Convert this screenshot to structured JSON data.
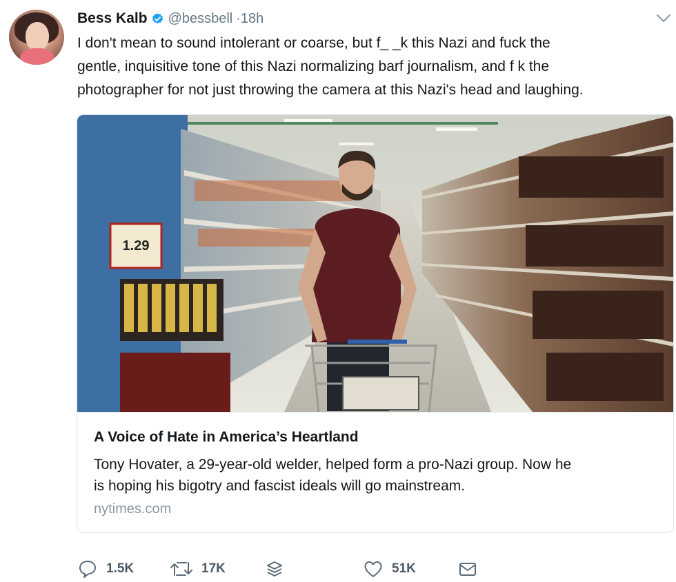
{
  "tweet": {
    "author_name": "Bess Kalb",
    "handle": "@bessbell",
    "separator": "·",
    "time": "18h",
    "text_lines": [
      "I don't mean to sound intolerant or coarse, but f_ _k this Nazi and fuck the",
      "gentle, inquisitive tone of this Nazi normalizing barf journalism, and f   k the",
      "photographer for not just throwing the camera at this Nazi's head and laughing."
    ]
  },
  "card": {
    "title": "A Voice of Hate in America’s Heartland",
    "description_lines": [
      "Tony Hovater, a 29-year-old welder, helped form a pro-Nazi group. Now he",
      "is hoping his bigotry and fascist ideals will go mainstream."
    ],
    "domain": "nytimes.com",
    "image_price_tag": "1.29"
  },
  "actions": {
    "reply_count": "1.5K",
    "retweet_count": "17K",
    "like_count": "51K"
  },
  "icons": {
    "verified": "verified-badge-icon",
    "more": "chevron-down-icon",
    "reply": "reply-icon",
    "retweet": "retweet-icon",
    "stack": "stack-icon",
    "like": "heart-icon",
    "message": "envelope-icon"
  },
  "colors": {
    "text": "#14171a",
    "secondary": "#657786",
    "verified": "#1da1f2",
    "action_icon": "#5b6b79"
  }
}
